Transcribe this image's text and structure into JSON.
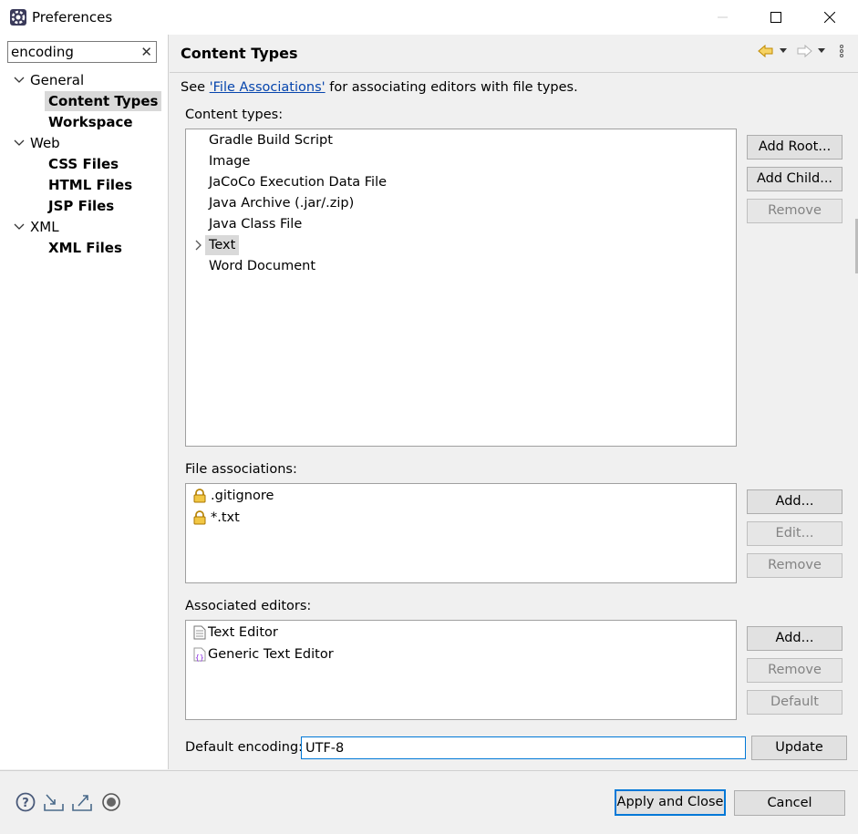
{
  "window": {
    "title": "Preferences"
  },
  "filter": {
    "value": "encoding"
  },
  "tree": {
    "general": "General",
    "content_types": "Content Types",
    "workspace": "Workspace",
    "web": "Web",
    "css_files": "CSS Files",
    "html_files": "HTML Files",
    "jsp_files": "JSP Files",
    "xml": "XML",
    "xml_files": "XML Files"
  },
  "page": {
    "title": "Content Types",
    "see_prefix": "See ",
    "see_link": "'File Associations'",
    "see_suffix": " for associating editors with file types."
  },
  "content_types": {
    "label": "Content types:",
    "items": [
      "Gradle Build Script",
      "Image",
      "JaCoCo Execution Data File",
      "Java Archive (.jar/.zip)",
      "Java Class File",
      "Text",
      "Word Document"
    ],
    "selected": "Text",
    "add_root": "Add Root...",
    "add_child": "Add Child...",
    "remove": "Remove"
  },
  "file_associations": {
    "label": "File associations:",
    "items": [
      ".gitignore",
      "*.txt"
    ],
    "add": "Add...",
    "edit": "Edit...",
    "remove": "Remove"
  },
  "associated_editors": {
    "label": "Associated editors:",
    "items": [
      "Text Editor",
      "Generic Text Editor"
    ],
    "add": "Add...",
    "remove": "Remove",
    "default": "Default"
  },
  "encoding": {
    "label": "Default encoding:",
    "value": "UTF-8",
    "update": "Update"
  },
  "footer": {
    "apply_close": "Apply and Close",
    "cancel": "Cancel"
  },
  "colors": {
    "accent": "#0078d7",
    "link": "#0645ad",
    "selection": "#d9d9d9"
  }
}
